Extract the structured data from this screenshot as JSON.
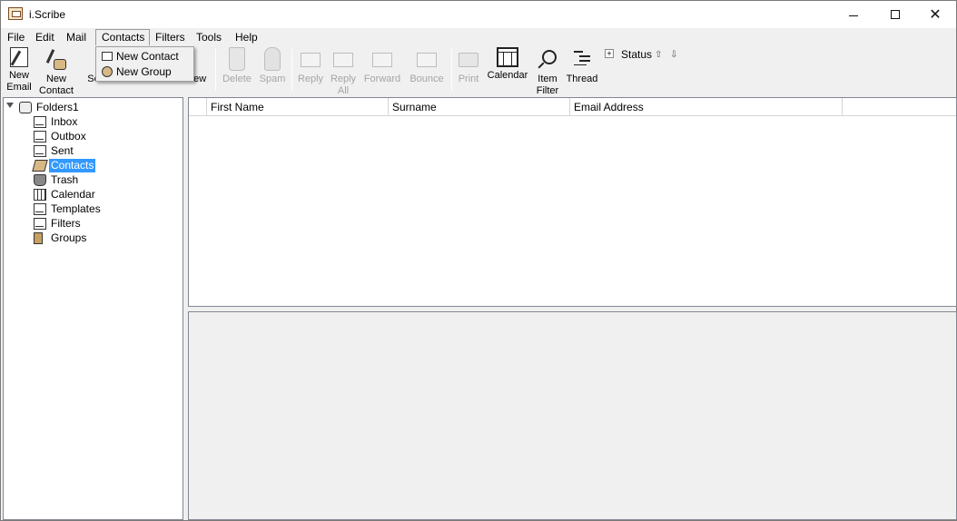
{
  "window": {
    "title": "i.Scribe",
    "min_icon": "minimize-icon",
    "max_icon": "maximize-icon",
    "close_icon": "close-icon"
  },
  "menubar": {
    "items": [
      {
        "label": "File",
        "accel": "F"
      },
      {
        "label": "Edit",
        "accel": "E"
      },
      {
        "label": "Mail",
        "accel": "M"
      },
      {
        "label": "Contacts",
        "accel": "C"
      },
      {
        "label": "Filters",
        "accel": "i"
      },
      {
        "label": "Tools",
        "accel": "T"
      },
      {
        "label": "Help",
        "accel": "H"
      }
    ],
    "open_menu": "Contacts"
  },
  "contacts_menu": {
    "items": [
      {
        "label": "New Contact",
        "icon": "contact-card-icon"
      },
      {
        "label": "New Group",
        "icon": "group-icon"
      }
    ]
  },
  "toolbar": {
    "new_email": [
      "New",
      "Email"
    ],
    "new_contact": [
      "New",
      "Contact"
    ],
    "send_partial": "Se",
    "view_partial": "iew",
    "delete": "Delete",
    "spam": "Spam",
    "reply": "Reply",
    "reply_all": [
      "Reply",
      "All"
    ],
    "forward": "Forward",
    "bounce": "Bounce",
    "print": "Print",
    "calendar": "Calendar",
    "item_filter": [
      "Item",
      "Filter"
    ],
    "thread": "Thread",
    "status": "Status"
  },
  "folders": {
    "root": "Folders1",
    "items": [
      {
        "label": "Inbox",
        "icon": "inbox-icon"
      },
      {
        "label": "Outbox",
        "icon": "outbox-icon"
      },
      {
        "label": "Sent",
        "icon": "sent-icon"
      },
      {
        "label": "Contacts",
        "icon": "contacts-icon",
        "selected": true
      },
      {
        "label": "Trash",
        "icon": "trash-icon"
      },
      {
        "label": "Calendar",
        "icon": "calendar-icon"
      },
      {
        "label": "Templates",
        "icon": "templates-icon"
      },
      {
        "label": "Filters",
        "icon": "filters-icon"
      },
      {
        "label": "Groups",
        "icon": "groups-icon"
      }
    ]
  },
  "list": {
    "columns": [
      "First Name",
      "Surname",
      "Email Address"
    ],
    "rows": []
  },
  "colors": {
    "selection": "#3399ff",
    "disabled_text": "#a5a5a5"
  }
}
